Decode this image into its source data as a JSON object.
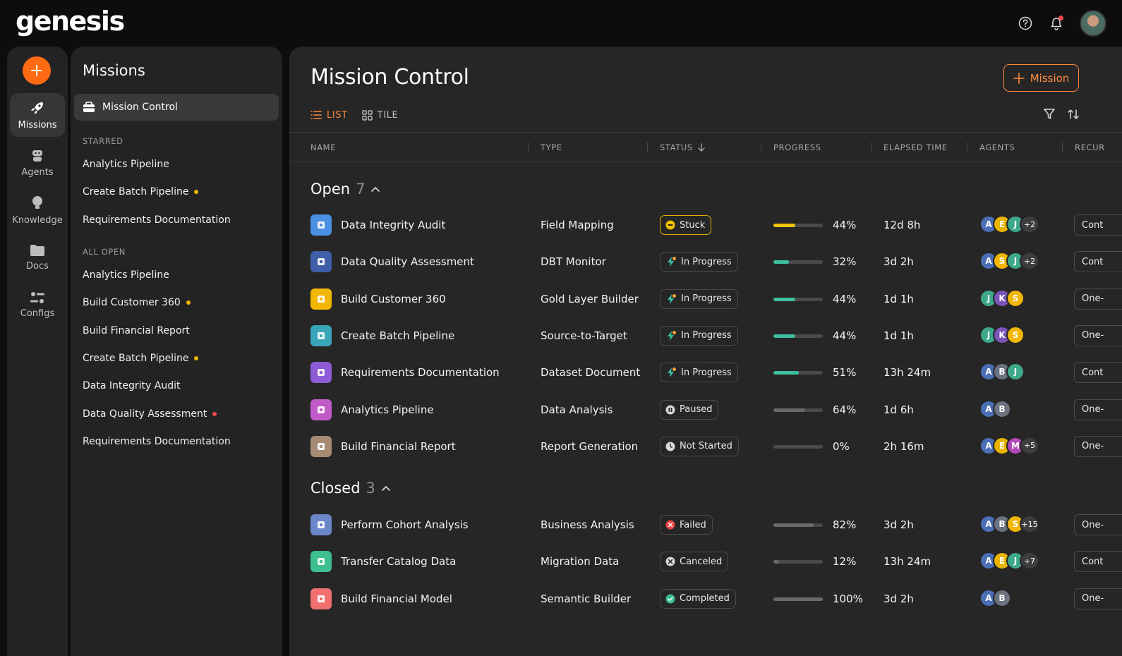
{
  "brand": {
    "logo_text": "genesis",
    "accent": "#ff6a13"
  },
  "topbar": {
    "help_icon": "help-circle-icon",
    "bell_icon": "bell-icon",
    "avatar": "user-avatar"
  },
  "rail": {
    "items": [
      {
        "label": "Missions",
        "icon": "rocket-icon"
      },
      {
        "label": "Agents",
        "icon": "robot-icon"
      },
      {
        "label": "Knowledge",
        "icon": "lightbulb-icon"
      },
      {
        "label": "Docs",
        "icon": "folder-icon"
      },
      {
        "label": "Configs",
        "icon": "sliders-icon"
      }
    ]
  },
  "sidebar": {
    "title": "Missions",
    "active": "Mission Control",
    "starred_label": "STARRED",
    "starred": [
      {
        "label": "Analytics Pipeline",
        "dot": ""
      },
      {
        "label": "Create Batch Pipeline",
        "dot": "#f2b705"
      },
      {
        "label": "Requirements Documentation",
        "dot": ""
      }
    ],
    "all_open_label": "ALL OPEN",
    "all_open": [
      {
        "label": "Analytics Pipeline",
        "dot": ""
      },
      {
        "label": "Build Customer 360",
        "dot": "#f2b705"
      },
      {
        "label": "Build Financial Report",
        "dot": ""
      },
      {
        "label": "Create Batch Pipeline",
        "dot": "#f2b705"
      },
      {
        "label": "Data Integrity Audit",
        "dot": ""
      },
      {
        "label": "Data Quality Assessment",
        "dot": "#f04848"
      },
      {
        "label": "Requirements Documentation",
        "dot": ""
      }
    ]
  },
  "main": {
    "title": "Mission Control",
    "add_button": "Mission",
    "tabs": {
      "list": "LIST",
      "tile": "TILE"
    },
    "columns": {
      "name": "NAME",
      "type": "TYPE",
      "status": "STATUS",
      "progress": "PROGRESS",
      "elapsed": "ELAPSED TIME",
      "agents": "AGENTS",
      "recur": "RECUR"
    }
  },
  "groups": {
    "open": {
      "label": "Open",
      "count": "7",
      "rows": [
        {
          "name": "Data Integrity Audit",
          "type": "Field Mapping",
          "status": "Stuck",
          "progress": 0.44,
          "pct": "44%",
          "elapsed": "12d 8h",
          "agents": [
            "A",
            "E",
            "J"
          ],
          "more": "+2",
          "recur": "Cont",
          "icon_color": "#4a90e2",
          "bar_color": "#f2c400"
        },
        {
          "name": "Data Quality Assessment",
          "type": "DBT Monitor",
          "status": "In Progress",
          "progress": 0.32,
          "pct": "32%",
          "elapsed": "3d 2h",
          "agents": [
            "A",
            "S",
            "J"
          ],
          "more": "+2",
          "recur": "Cont",
          "icon_color": "#3f5fa8",
          "bar_color": "#3dbfa0"
        },
        {
          "name": "Build Customer 360",
          "type": "Gold Layer Builder",
          "status": "In Progress",
          "progress": 0.44,
          "pct": "44%",
          "elapsed": "1d 1h",
          "agents": [
            "J",
            "K",
            "S"
          ],
          "more": "",
          "recur": "One-",
          "icon_color": "#f2b705",
          "bar_color": "#3dbfa0"
        },
        {
          "name": "Create Batch Pipeline",
          "type": "Source-to-Target",
          "status": "In Progress",
          "progress": 0.44,
          "pct": "44%",
          "elapsed": "1d 1h",
          "agents": [
            "J",
            "K",
            "S"
          ],
          "more": "",
          "recur": "One-",
          "icon_color": "#3aa6b9",
          "bar_color": "#3dbfa0"
        },
        {
          "name": "Requirements Documentation",
          "type": "Dataset Document",
          "status": "In Progress",
          "progress": 0.51,
          "pct": "51%",
          "elapsed": "13h 24m",
          "agents": [
            "A",
            "B",
            "J"
          ],
          "more": "",
          "recur": "Cont",
          "icon_color": "#8e5bd6",
          "bar_color": "#3dbfa0"
        },
        {
          "name": "Analytics Pipeline",
          "type": "Data Analysis",
          "status": "Paused",
          "progress": 0.64,
          "pct": "64%",
          "elapsed": "1d 6h",
          "agents": [
            "A",
            "B"
          ],
          "more": "",
          "recur": "One-",
          "icon_color": "#c05bc9",
          "bar_color": "#6a6a6a"
        },
        {
          "name": "Build Financial Report",
          "type": "Report Generation",
          "status": "Not Started",
          "progress": 0,
          "pct": "0%",
          "elapsed": "2h 16m",
          "agents": [
            "A",
            "E",
            "M"
          ],
          "more": "+5",
          "recur": "One-",
          "icon_color": "#a58b74",
          "bar_color": "#6a6a6a"
        }
      ]
    },
    "closed": {
      "label": "Closed",
      "count": "3",
      "rows": [
        {
          "name": "Perform Cohort Analysis",
          "type": "Business Analysis",
          "status": "Failed",
          "progress": 0.82,
          "pct": "82%",
          "elapsed": "3d 2h",
          "agents": [
            "A",
            "B",
            "S"
          ],
          "more": "+15",
          "recur": "One-",
          "icon_color": "#6b86c9",
          "bar_color": "#6a6a6a"
        },
        {
          "name": "Transfer Catalog Data",
          "type": "Migration Data",
          "status": "Canceled",
          "progress": 0.12,
          "pct": "12%",
          "elapsed": "13h 24m",
          "agents": [
            "A",
            "E",
            "J"
          ],
          "more": "+7",
          "recur": "Cont",
          "icon_color": "#3dbf8f",
          "bar_color": "#6a6a6a"
        },
        {
          "name": "Build Financial Model",
          "type": "Semantic Builder",
          "status": "Completed",
          "progress": 1,
          "pct": "100%",
          "elapsed": "3d 2h",
          "agents": [
            "A",
            "B"
          ],
          "more": "",
          "recur": "One-",
          "icon_color": "#f07070",
          "bar_color": "#6a6a6a"
        }
      ]
    }
  },
  "agent_colors": {
    "A": "#4a6fb5",
    "E": "#e8b400",
    "J": "#3da98a",
    "S": "#f2b705",
    "K": "#7a55b8",
    "B": "#6b7280",
    "M": "#b04ab8"
  }
}
